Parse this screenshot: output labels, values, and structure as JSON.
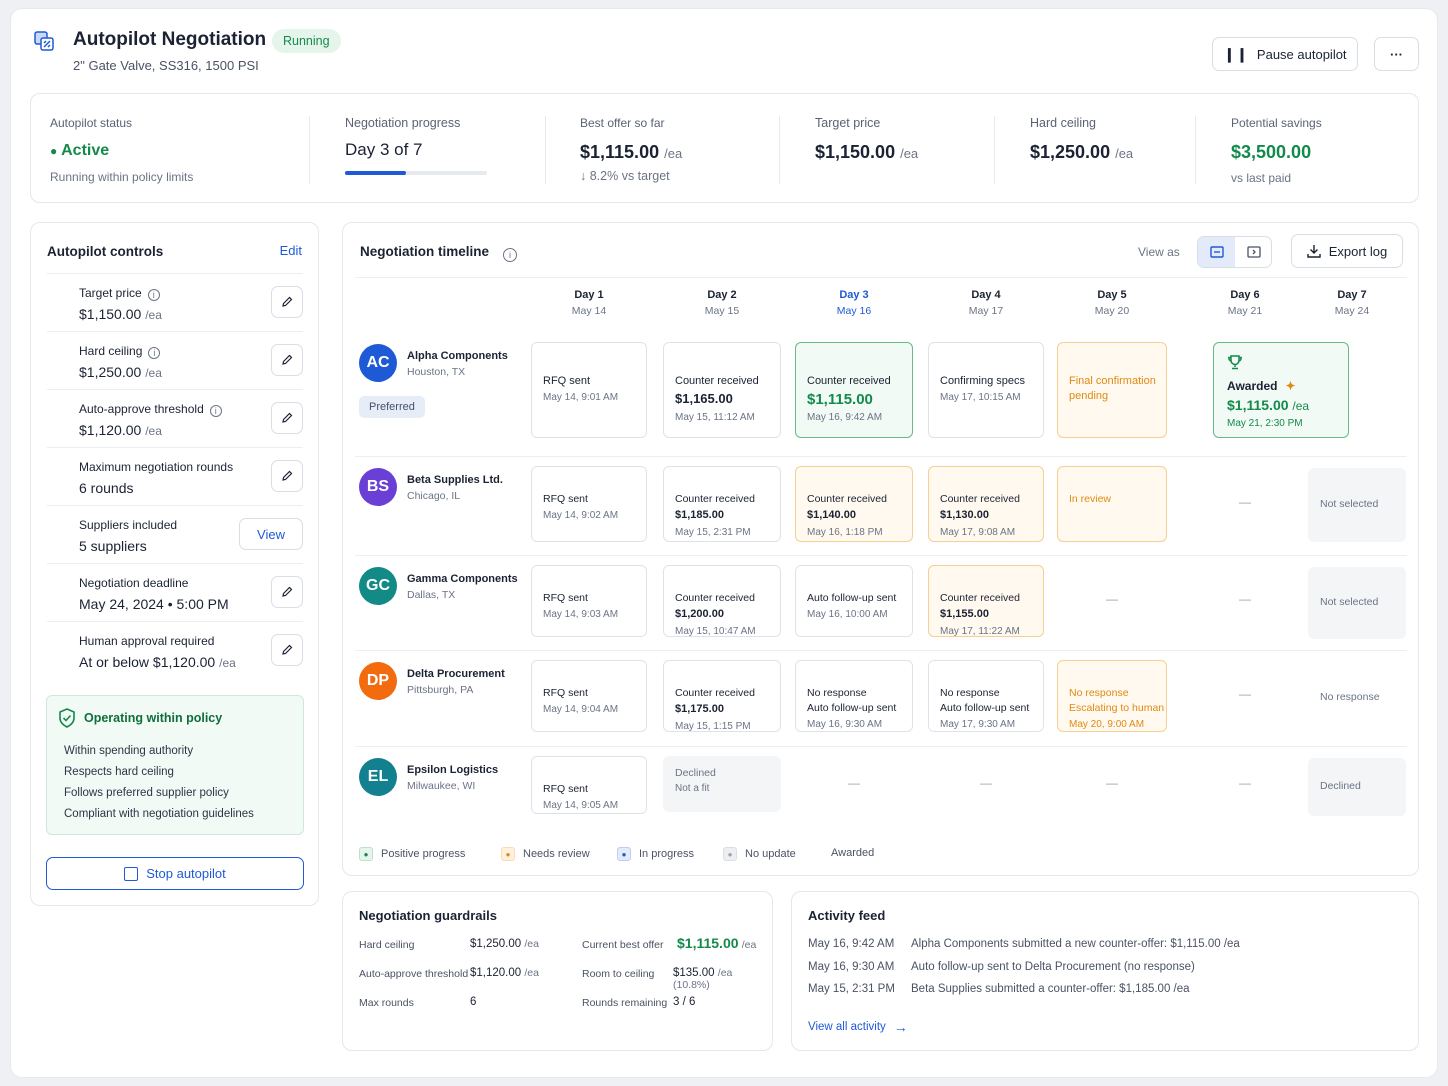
{
  "header": {
    "title": "Autopilot Negotiation",
    "status_badge": "Running",
    "subtitle": "2\" Gate Valve, SS316, 1500 PSI",
    "pause_label": "Pause autopilot",
    "more_label": "···"
  },
  "metrics": {
    "status": {
      "label": "Autopilot status",
      "value": "Active",
      "sub": "Running within policy limits"
    },
    "progress": {
      "label": "Negotiation progress",
      "value": "Day 3 of 7",
      "fraction": 0.43
    },
    "best_offer": {
      "label": "Best offer so far",
      "value": "$1,115.00",
      "unit": "/ea",
      "sub": "8.2% vs target"
    },
    "target": {
      "label": "Target price",
      "value": "$1,150.00",
      "unit": "/ea"
    },
    "ceiling": {
      "label": "Hard ceiling",
      "value": "$1,250.00",
      "unit": "/ea"
    },
    "savings": {
      "label": "Potential savings",
      "value": "$3,500.00",
      "sub": "vs last paid"
    }
  },
  "controls": {
    "title": "Autopilot controls",
    "edit": "Edit",
    "items": [
      {
        "title": "Target price",
        "value": "$1,150.00",
        "unit": "/ea"
      },
      {
        "title": "Hard ceiling",
        "value": "$1,250.00",
        "unit": "/ea"
      },
      {
        "title": "Auto-approve threshold",
        "value": "$1,120.00",
        "unit": "/ea"
      },
      {
        "title": "Maximum negotiation rounds",
        "value": "6 rounds"
      },
      {
        "title": "Suppliers included",
        "value": "5 suppliers",
        "action": "View"
      },
      {
        "title": "Negotiation deadline",
        "value": "May 24, 2024 • 5:00 PM"
      },
      {
        "title": "Human approval required",
        "value": "At or below $1,120.00",
        "unit": "/ea"
      }
    ],
    "policy": {
      "title": "Operating within policy",
      "items": [
        "Within spending authority",
        "Respects hard ceiling",
        "Follows preferred supplier policy",
        "Compliant with negotiation guidelines"
      ]
    },
    "stop": "Stop autopilot"
  },
  "timeline": {
    "title": "Negotiation timeline",
    "view_as": "View as",
    "export": "Export log",
    "days": [
      {
        "d": "Day 1",
        "m": "May 14"
      },
      {
        "d": "Day 2",
        "m": "May 15"
      },
      {
        "d": "Day 3",
        "m": "May 16"
      },
      {
        "d": "Day 4",
        "m": "May 17"
      },
      {
        "d": "Day 5",
        "m": "May 20"
      },
      {
        "d": "Day 6",
        "m": "May 21"
      },
      {
        "d": "Day 7",
        "m": "May 24"
      }
    ],
    "suppliers": [
      {
        "initials": "AC",
        "name": "Alpha Components",
        "location": "Houston, TX",
        "tag": "Preferred",
        "cells": [
          {
            "l1": "RFQ sent",
            "l3": "May 14, 9:01 AM"
          },
          {
            "l1": "Counter received",
            "l2": "$1,165.00",
            "l3": "May 15, 11:12 AM"
          },
          {
            "l1": "Counter received",
            "l2": "$1,115.00",
            "l3": "May 16, 9:42 AM"
          },
          {
            "l1": "Confirming specs",
            "l3": "May 17, 10:15 AM"
          },
          {
            "l1": "Final confirmation",
            "l1b": "pending"
          },
          {
            "l1": "Awarded",
            "l2": "$1,115.00",
            "unit": "/ea",
            "l3": "May 21, 2:30 PM"
          }
        ]
      },
      {
        "initials": "BS",
        "name": "Beta Supplies Ltd.",
        "location": "Chicago, IL",
        "cells": [
          {
            "l1": "RFQ sent",
            "l3": "May 14, 9:02 AM"
          },
          {
            "l1": "Counter received",
            "l2": "$1,185.00",
            "l3": "May 15, 2:31 PM"
          },
          {
            "l1": "Counter received",
            "l2": "$1,140.00",
            "l3": "May 16, 1:18 PM"
          },
          {
            "l1": "Counter received",
            "l2": "$1,130.00",
            "l3": "May 17, 9:08 AM"
          },
          {
            "l1": "In review"
          },
          {
            "dash": "—"
          },
          {
            "l1": "Not selected"
          }
        ]
      },
      {
        "initials": "GC",
        "name": "Gamma Components",
        "location": "Dallas, TX",
        "cells": [
          {
            "l1": "RFQ sent",
            "l3": "May 14, 9:03 AM"
          },
          {
            "l1": "Counter received",
            "l2": "$1,200.00",
            "l3": "May 15, 10:47 AM"
          },
          {
            "l1": "Auto follow-up sent",
            "l3": "May 16, 10:00 AM"
          },
          {
            "l1": "Counter received",
            "l2": "$1,155.00",
            "l3": "May 17, 11:22 AM"
          },
          {
            "dash": "—"
          },
          {
            "dash": "—"
          },
          {
            "l1": "Not selected"
          }
        ]
      },
      {
        "initials": "DP",
        "name": "Delta Procurement",
        "location": "Pittsburgh, PA",
        "cells": [
          {
            "l1": "RFQ sent",
            "l3": "May 14, 9:04 AM"
          },
          {
            "l1": "Counter received",
            "l2": "$1,175.00",
            "l3": "May 15, 1:15 PM"
          },
          {
            "l1": "No response",
            "l1b": "Auto follow-up sent",
            "l3": "May 16, 9:30 AM"
          },
          {
            "l1": "No response",
            "l1b": "Auto follow-up sent",
            "l3": "May 17, 9:30 AM"
          },
          {
            "l1": "No response",
            "l1b": "Escalating to human",
            "l3": "May 20, 9:00 AM"
          },
          {
            "dash": "—"
          },
          {
            "l1": "No response"
          }
        ]
      },
      {
        "initials": "EL",
        "name": "Epsilon Logistics",
        "location": "Milwaukee, WI",
        "cells": [
          {
            "l1": "RFQ sent",
            "l3": "May 14, 9:05 AM"
          },
          {
            "l1": "Declined",
            "l1b": "Not a fit"
          },
          {
            "dash": "—"
          },
          {
            "dash": "—"
          },
          {
            "dash": "—"
          },
          {
            "dash": "—"
          },
          {
            "l1": "Declined"
          }
        ]
      }
    ],
    "legend": [
      "Positive progress",
      "Needs review",
      "In progress",
      "No update",
      "Awarded"
    ]
  },
  "guardrails": {
    "title": "Negotiation guardrails",
    "left": [
      {
        "k": "Hard ceiling",
        "v": "$1,250.00",
        "u": "/ea"
      },
      {
        "k": "Auto-approve threshold",
        "v": "$1,120.00",
        "u": "/ea"
      },
      {
        "k": "Max rounds",
        "v": "6"
      }
    ],
    "right": [
      {
        "k": "Current best offer",
        "v": "$1,115.00",
        "u": "/ea"
      },
      {
        "k": "Room to ceiling",
        "v": "$135.00",
        "u": "/ea (10.8%)"
      },
      {
        "k": "Rounds remaining",
        "v": "3 / 6"
      }
    ]
  },
  "activity": {
    "title": "Activity feed",
    "items": [
      {
        "t": "May 16, 9:42 AM",
        "m": "Alpha Components submitted a new counter-offer: $1,115.00 /ea"
      },
      {
        "t": "May 16, 9:30 AM",
        "m": "Auto follow-up sent to Delta Procurement (no response)"
      },
      {
        "t": "May 15, 2:31 PM",
        "m": "Beta Supplies submitted a counter-offer: $1,185.00 /ea"
      }
    ],
    "view_all": "View all activity"
  },
  "colors": {
    "accent": "#1f5ad6",
    "positive": "#138a4b",
    "warning": "#e08a12"
  }
}
